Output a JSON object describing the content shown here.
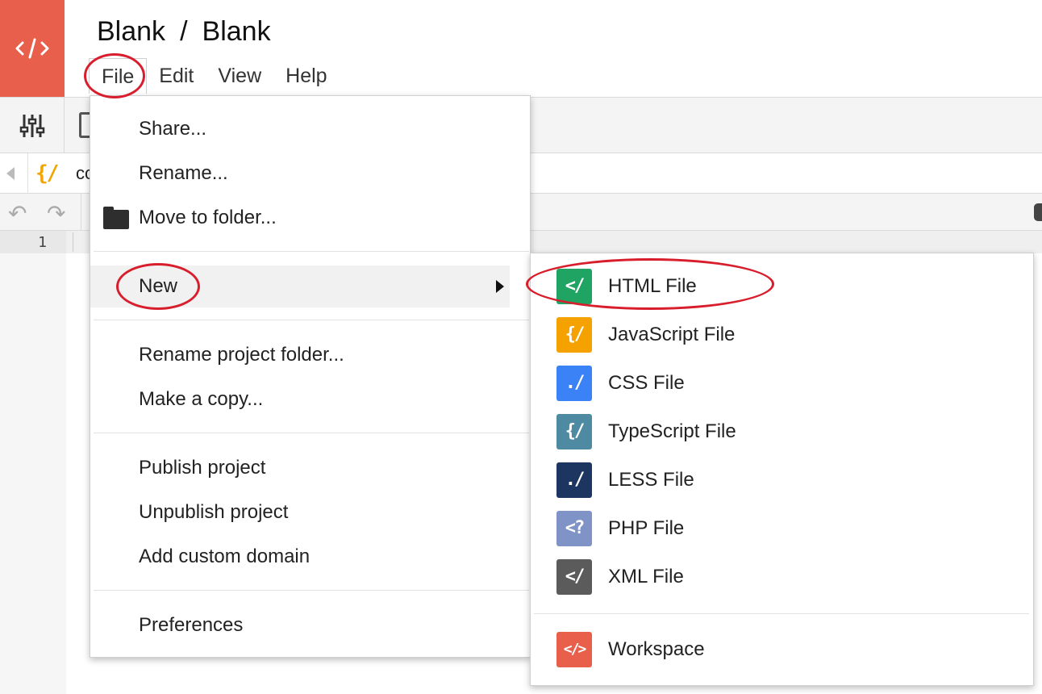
{
  "header": {
    "title_left": "Blank",
    "title_separator": "/",
    "title_right": "Blank",
    "logo_icon": "code-brackets-icon",
    "logo_color": "#e8604c"
  },
  "menubar": {
    "items": [
      {
        "label": "File",
        "active": true
      },
      {
        "label": "Edit"
      },
      {
        "label": "View"
      },
      {
        "label": "Help"
      }
    ]
  },
  "editor": {
    "tab_label": "cc",
    "line_number": "1"
  },
  "file_menu": {
    "items": [
      {
        "label": "Share..."
      },
      {
        "label": "Rename..."
      },
      {
        "label": "Move to folder...",
        "icon": "folder-icon"
      },
      {
        "label": "New",
        "has_submenu": true,
        "highlighted": true
      },
      {
        "label": "Rename project folder..."
      },
      {
        "label": "Make a copy..."
      },
      {
        "label": "Publish project"
      },
      {
        "label": "Unpublish project"
      },
      {
        "label": "Add custom domain"
      },
      {
        "label": "Preferences"
      }
    ]
  },
  "new_submenu": {
    "items": [
      {
        "label": "HTML File",
        "icon": "html-file-icon",
        "color": "#1fa463",
        "glyph": "</"
      },
      {
        "label": "JavaScript File",
        "icon": "javascript-file-icon",
        "color": "#f5a200",
        "glyph": "{/"
      },
      {
        "label": "CSS File",
        "icon": "css-file-icon",
        "color": "#3b82f6",
        "glyph": "./"
      },
      {
        "label": "TypeScript File",
        "icon": "typescript-file-icon",
        "color": "#4f8aa3",
        "glyph": "{/"
      },
      {
        "label": "LESS File",
        "icon": "less-file-icon",
        "color": "#1c3661",
        "glyph": "./"
      },
      {
        "label": "PHP File",
        "icon": "php-file-icon",
        "color": "#7f93c6",
        "glyph": "<?"
      },
      {
        "label": "XML File",
        "icon": "xml-file-icon",
        "color": "#5b5b5b",
        "glyph": "</"
      },
      {
        "label": "Workspace",
        "icon": "workspace-icon",
        "color": "#e8604c",
        "glyph": "</>"
      }
    ]
  },
  "annotations": {
    "highlight_color": "#d81e2c"
  }
}
